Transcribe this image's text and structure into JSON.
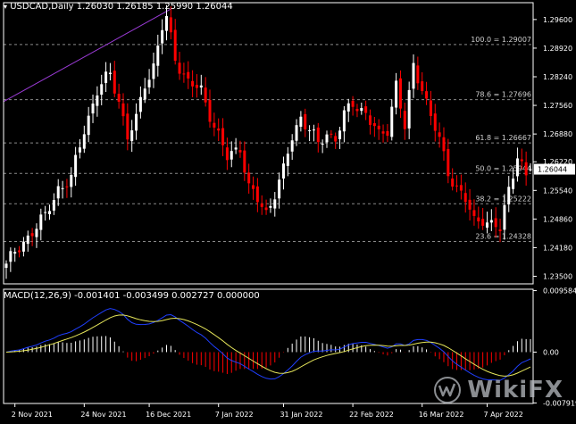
{
  "symbol_header": "USDCAD,Daily  1.26030 1.26185 1.25990 1.26044",
  "price_panel": {
    "ylim": [
      1.2332,
      1.3
    ],
    "price_labels": [
      "1.29600",
      "1.28920",
      "1.28240",
      "1.27560",
      "1.26880",
      "1.26220",
      "1.25540",
      "1.24860",
      "1.24180",
      "1.23500"
    ],
    "price_values": [
      1.296,
      1.2892,
      1.2824,
      1.2756,
      1.2688,
      1.2622,
      1.2554,
      1.2486,
      1.2418,
      1.235
    ],
    "current_price_label": "1.26044",
    "current_price": 1.26044,
    "trendline_color": "#9b3bd6",
    "up_color": "#ffffff",
    "down_color": "#ff0000",
    "fib_levels": [
      {
        "label": "100.0 = 1.29007",
        "value": 1.29007
      },
      {
        "label": "78.6 = 1.27696",
        "value": 1.27696
      },
      {
        "label": "61.8 = 1.26667",
        "value": 1.26667
      },
      {
        "label": "50.0 = 1.25944",
        "value": 1.25944
      },
      {
        "label": "38.2 = 1.25222",
        "value": 1.25222
      },
      {
        "label": "23.6 = 1.24328",
        "value": 1.24328
      }
    ]
  },
  "macd_panel": {
    "title": "MACD(12,26,9) -0.001401 -0.003499 0.002727 0.000000",
    "ylim": [
      -0.008,
      0.0098
    ],
    "labels": [
      "0.009584",
      "0.00",
      "-0.007919"
    ],
    "label_values": [
      0.009584,
      0.0,
      -0.007919
    ],
    "main_color": "#1f3fff",
    "signal_color": "#e6e65a",
    "hist_up_color": "#ffffff",
    "hist_down_color": "#ff0000"
  },
  "date_labels": [
    "2 Nov 2021",
    "24 Nov 2021",
    "16 Dec 2021",
    "7 Jan 2022",
    "31 Jan 2022",
    "22 Feb 2022",
    "16 Mar 2022",
    "7 Apr 2022"
  ],
  "watermark": {
    "text": "WikiFX",
    "icon": "wikifx-logo-icon"
  },
  "chart_data": {
    "type": "candlestick",
    "title": "USDCAD,Daily",
    "ylim": [
      1.2332,
      1.3
    ],
    "x": [
      "2 Nov 2021",
      "24 Nov 2021",
      "16 Dec 2021",
      "7 Jan 2022",
      "31 Jan 2022",
      "22 Feb 2022",
      "16 Mar 2022",
      "7 Apr 2022"
    ],
    "closes_anchor": [
      [
        0,
        1.238
      ],
      [
        3,
        1.2415
      ],
      [
        6,
        1.246
      ],
      [
        9,
        1.249
      ],
      [
        12,
        1.256
      ],
      [
        15,
        1.258
      ],
      [
        18,
        1.27
      ],
      [
        21,
        1.279
      ],
      [
        24,
        1.283
      ],
      [
        26,
        1.277
      ],
      [
        28,
        1.268
      ],
      [
        30,
        1.272
      ],
      [
        32,
        1.281
      ],
      [
        34,
        1.285
      ],
      [
        36,
        1.294
      ],
      [
        37,
        1.296
      ],
      [
        39,
        1.287
      ],
      [
        42,
        1.281
      ],
      [
        45,
        1.279
      ],
      [
        48,
        1.271
      ],
      [
        51,
        1.263
      ],
      [
        54,
        1.266
      ],
      [
        56,
        1.256
      ],
      [
        58,
        1.253
      ],
      [
        60,
        1.25
      ],
      [
        62,
        1.255
      ],
      [
        64,
        1.26
      ],
      [
        66,
        1.268
      ],
      [
        68,
        1.273
      ],
      [
        70,
        1.27
      ],
      [
        72,
        1.266
      ],
      [
        74,
        1.269
      ],
      [
        76,
        1.268
      ],
      [
        78,
        1.273
      ],
      [
        80,
        1.276
      ],
      [
        83,
        1.274
      ],
      [
        86,
        1.268
      ],
      [
        88,
        1.27
      ],
      [
        90,
        1.281
      ],
      [
        92,
        1.27
      ],
      [
        94,
        1.285
      ],
      [
        96,
        1.28
      ],
      [
        98,
        1.273
      ],
      [
        100,
        1.267
      ],
      [
        102,
        1.26
      ],
      [
        104,
        1.256
      ],
      [
        106,
        1.253
      ],
      [
        108,
        1.248
      ],
      [
        110,
        1.249
      ],
      [
        112,
        1.247
      ],
      [
        114,
        1.246
      ],
      [
        116,
        1.256
      ],
      [
        118,
        1.264
      ],
      [
        120,
        1.258
      ],
      [
        121,
        1.26044
      ]
    ],
    "ohlc_last": {
      "open": 1.2603,
      "high": 1.26185,
      "low": 1.2599,
      "close": 1.26044
    },
    "macd": {
      "main_last": -0.001401,
      "signal_last": -0.003499,
      "hist_last": 0.002727
    }
  }
}
